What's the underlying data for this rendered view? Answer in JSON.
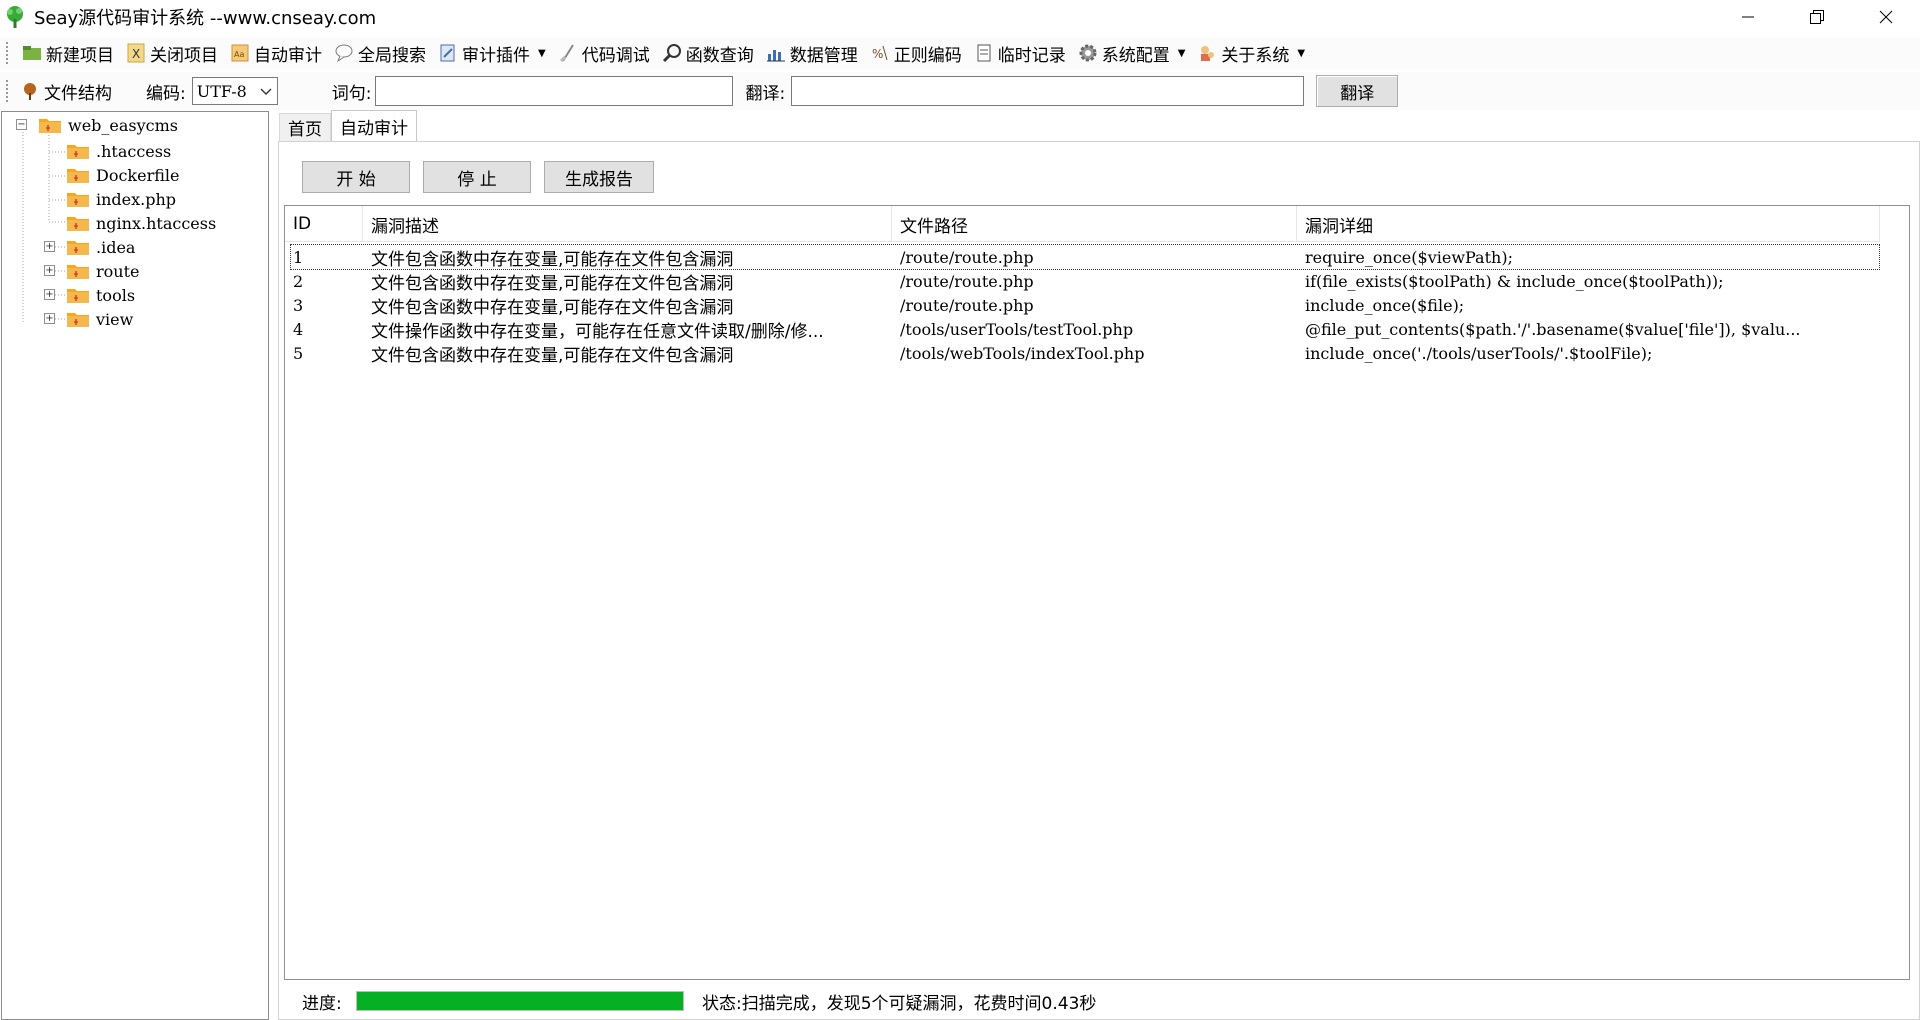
{
  "window": {
    "title": "Seay源代码审计系统  --www.cnseay.com"
  },
  "toolbar": {
    "items": [
      {
        "label": "新建项目",
        "icon": "new-project-icon"
      },
      {
        "label": "关闭项目",
        "icon": "close-project-icon"
      },
      {
        "label": "自动审计",
        "icon": "auto-audit-icon"
      },
      {
        "label": "全局搜索",
        "icon": "search-icon"
      },
      {
        "label": "审计插件",
        "icon": "plugin-icon",
        "dropdown": true
      },
      {
        "label": "代码调试",
        "icon": "debug-icon"
      },
      {
        "label": "函数查询",
        "icon": "magnifier-icon"
      },
      {
        "label": "数据管理",
        "icon": "chart-icon"
      },
      {
        "label": "正则编码",
        "icon": "regex-icon"
      },
      {
        "label": "临时记录",
        "icon": "notes-icon"
      },
      {
        "label": "系统配置",
        "icon": "gear-icon",
        "dropdown": true
      },
      {
        "label": "关于系统",
        "icon": "about-icon",
        "dropdown": true
      }
    ]
  },
  "bar2": {
    "file_structure_label": "文件结构",
    "encoding_label": "编码:",
    "encoding_value": "UTF-8",
    "phrase_label": "词句:",
    "phrase_value": "",
    "translate_label": "翻译:",
    "translate_value": "",
    "translate_button": "翻译"
  },
  "tree": {
    "root": "web_easycms",
    "files": [
      ".htaccess",
      "Dockerfile",
      "index.php",
      "nginx.htaccess"
    ],
    "folders": [
      ".idea",
      "route",
      "tools",
      "view"
    ]
  },
  "tabs": [
    {
      "label": "首页",
      "active": false
    },
    {
      "label": "自动审计",
      "active": true
    }
  ],
  "actions": {
    "start": "开 始",
    "stop": "停 止",
    "report": "生成报告"
  },
  "table": {
    "columns": [
      "ID",
      "漏洞描述",
      "文件路径",
      "漏洞详细"
    ],
    "rows": [
      {
        "id": "1",
        "desc": "文件包含函数中存在变量,可能存在文件包含漏洞",
        "path": "/route/route.php",
        "detail": "require_once($viewPath);"
      },
      {
        "id": "2",
        "desc": "文件包含函数中存在变量,可能存在文件包含漏洞",
        "path": "/route/route.php",
        "detail": "if(file_exists($toolPath) & include_once($toolPath));"
      },
      {
        "id": "3",
        "desc": "文件包含函数中存在变量,可能存在文件包含漏洞",
        "path": "/route/route.php",
        "detail": "include_once($file);"
      },
      {
        "id": "4",
        "desc": "文件操作函数中存在变量，可能存在任意文件读取/删除/修...",
        "path": "/tools/userTools/testTool.php",
        "detail": "@file_put_contents($path.'/'.basename($value['file']), $valu..."
      },
      {
        "id": "5",
        "desc": "文件包含函数中存在变量,可能存在文件包含漏洞",
        "path": "/tools/webTools/indexTool.php",
        "detail": "include_once('./tools/userTools/'.$toolFile);"
      }
    ]
  },
  "status": {
    "progress_label": "进度:",
    "progress_value": 1.0,
    "status_text": "状态:扫描完成，发现5个可疑漏洞，花费时间0.43秒"
  },
  "colors": {
    "progress": "#06b025",
    "folder": "#f5a623"
  }
}
